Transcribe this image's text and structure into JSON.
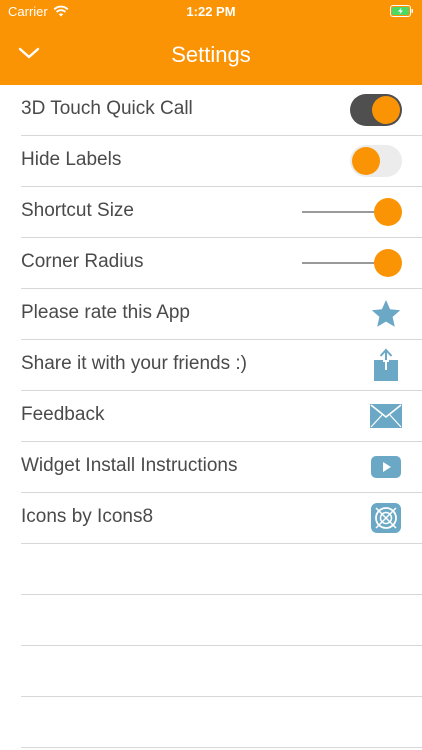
{
  "status_bar": {
    "carrier": "Carrier",
    "time": "1:22 PM"
  },
  "nav": {
    "title": "Settings"
  },
  "colors": {
    "accent": "#fb9404",
    "icon_blue": "#6aa8c6",
    "toggle_on_track": "#4f4f4f",
    "toggle_off_track": "#ececec"
  },
  "settings": {
    "touch_quick_call": {
      "label": "3D Touch Quick Call",
      "enabled": true
    },
    "hide_labels": {
      "label": "Hide Labels",
      "enabled": false
    },
    "shortcut_size": {
      "label": "Shortcut Size",
      "value": 1.0
    },
    "corner_radius": {
      "label": "Corner Radius",
      "value": 1.0
    },
    "rate_app": {
      "label": "Please rate this App",
      "icon": "star-icon"
    },
    "share": {
      "label": "Share it with your friends :)",
      "icon": "share-icon"
    },
    "feedback": {
      "label": "Feedback",
      "icon": "mail-icon"
    },
    "widget_instructions": {
      "label": "Widget Install Instructions",
      "icon": "youtube-icon"
    },
    "icons_credit": {
      "label": "Icons by Icons8",
      "icon": "icons8-icon"
    }
  }
}
